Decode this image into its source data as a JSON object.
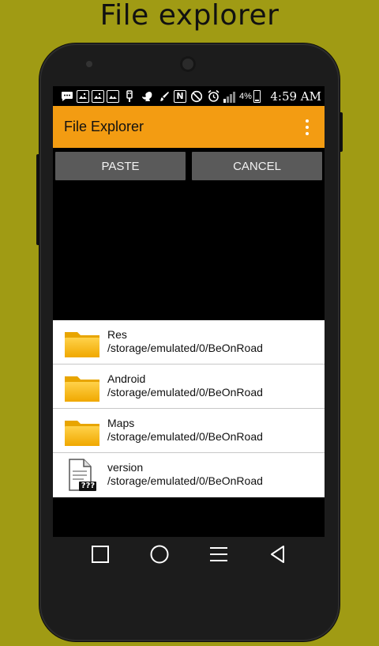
{
  "promo": {
    "title": "File explorer"
  },
  "status_bar": {
    "nfc_label": "N",
    "battery_percent": "4%",
    "time": "4:59 AM"
  },
  "app_bar": {
    "title": "File Explorer"
  },
  "actions": {
    "paste_label": "PASTE",
    "cancel_label": "CANCEL"
  },
  "files": [
    {
      "name": "Res",
      "path": "/storage/emulated/0/BeOnRoad",
      "icon": "folder-icon"
    },
    {
      "name": "Android",
      "path": "/storage/emulated/0/BeOnRoad",
      "icon": "folder-icon"
    },
    {
      "name": "Maps",
      "path": "/storage/emulated/0/BeOnRoad",
      "icon": "folder-icon"
    },
    {
      "name": "version",
      "path": "/storage/emulated/0/BeOnRoad",
      "icon": "unknown-file-icon",
      "badge": "???"
    }
  ],
  "colors": {
    "background": "#a09b14",
    "accent": "#f39c12",
    "button": "#5a5a5a",
    "folder": "#f5b400"
  }
}
